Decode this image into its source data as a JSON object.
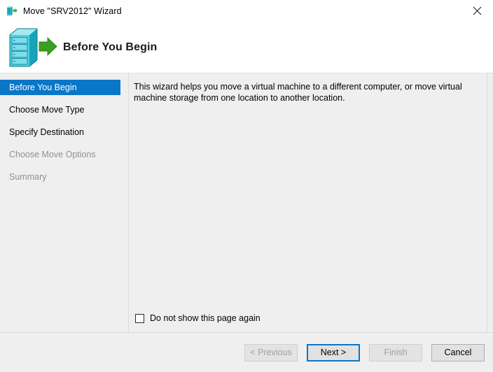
{
  "window": {
    "title": "Move \"SRV2012\" Wizard",
    "title_icon": "server-move-icon",
    "close_icon": "close-icon"
  },
  "header": {
    "title": "Before You Begin",
    "icon": "server-move-banner-icon"
  },
  "sidebar": {
    "items": [
      {
        "label": "Before You Begin",
        "state": "selected"
      },
      {
        "label": "Choose Move Type",
        "state": "enabled"
      },
      {
        "label": "Specify Destination",
        "state": "enabled"
      },
      {
        "label": "Choose Move Options",
        "state": "disabled"
      },
      {
        "label": "Summary",
        "state": "disabled"
      }
    ]
  },
  "content": {
    "body_text": "This wizard helps you move a virtual machine to a different computer, or move virtual machine storage from one location to another location.",
    "checkbox_label": "Do not show this page again",
    "checkbox_checked": false
  },
  "footer": {
    "buttons": [
      {
        "label": "< Previous",
        "state": "disabled"
      },
      {
        "label": "Next >",
        "state": "focused"
      },
      {
        "label": "Finish",
        "state": "disabled"
      },
      {
        "label": "Cancel",
        "state": "enabled"
      }
    ]
  },
  "colors": {
    "accent_blue": "#0a76c8",
    "window_background": "#efefef",
    "title_bar_background": "#ffffff",
    "icon_teal": "#2ec4d4",
    "icon_green": "#3aa021"
  }
}
